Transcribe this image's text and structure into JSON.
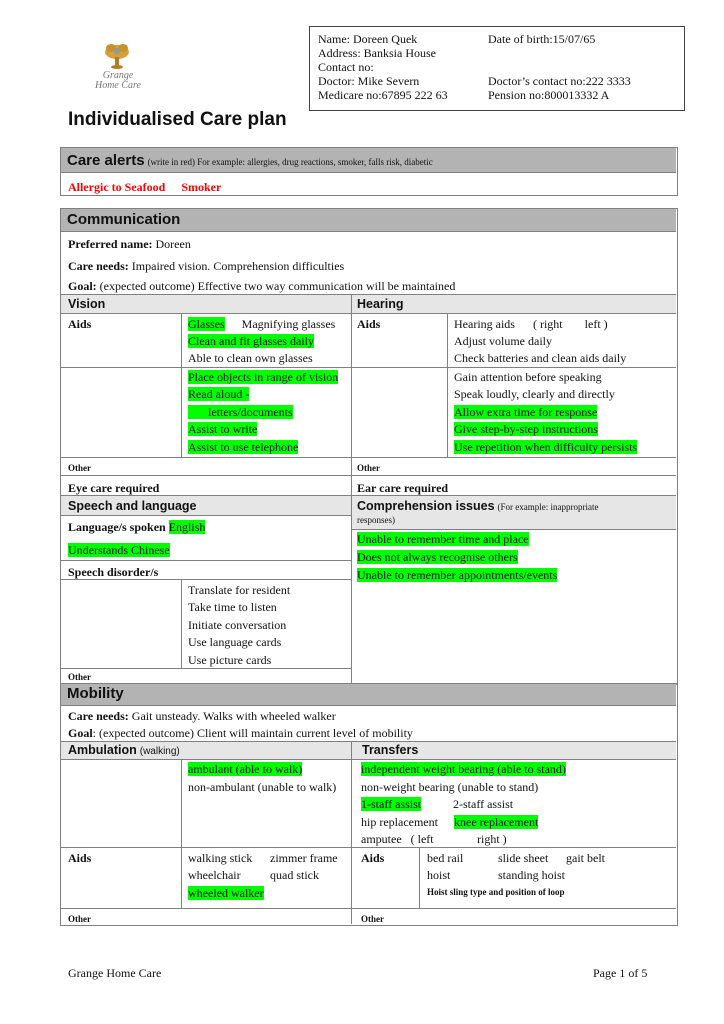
{
  "logo": {
    "line1": "Grange",
    "line2": "Home Care",
    "icon": "flower-logo-icon"
  },
  "title": "Individualised Care plan",
  "patient": {
    "name": "Name: Doreen Quek",
    "dob": "Date of birth:15/07/65",
    "address": "Address: Banksia House",
    "contact": "Contact no:",
    "doctor": "Doctor: Mike Severn",
    "doctor_contact": "Doctor’s contact no:222 3333",
    "medicare": "Medicare no:67895 222 63",
    "pension": "Pension no:800013332 A"
  },
  "care_alerts": {
    "heading": "Care alerts",
    "hint": "(write in red)  For example: allergies, drug reactions, smoker, falls risk, diabetic",
    "alerts": [
      "Allergic to Seafood",
      "Smoker"
    ],
    "alert_color": "#ff0000"
  },
  "communication": {
    "heading": "Communication",
    "preferred_name_label": "Preferred name:",
    "preferred_name": " Doreen",
    "care_needs_label": "Care needs:",
    "care_needs": " Impaired vision.  Comprehension difficulties",
    "goal_label": "Goal:",
    "goal": " (expected outcome) Effective two way communication will be maintained",
    "vision": {
      "heading": "Vision",
      "aids_label": "Aids",
      "aids": {
        "glasses": "Glasses",
        "magnifying": "Magnifying glasses",
        "clean_fit": "Clean and fit glasses daily",
        "able_clean": "Able to clean own glasses"
      },
      "support": [
        "Place objects in range of vision",
        "Read aloud -",
        "      letters/documents",
        "Assist to write",
        "Assist to use telephone"
      ],
      "other_label": "Other",
      "eye_care": "Eye care required"
    },
    "hearing": {
      "heading": "Hearing",
      "aids_label": "Aids",
      "aids": {
        "hearing_aids": "Hearing aids",
        "right": "( right",
        "left": "left )",
        "adjust": "Adjust volume daily",
        "check": "Check batteries and clean aids daily"
      },
      "support": [
        "Gain attention before speaking",
        "Speak loudly, clearly and directly",
        "Allow extra time for response",
        "Give step-by-step instructions",
        "Use repetition when difficulty persists"
      ],
      "other_label": "Other",
      "ear_care": "Ear care required"
    },
    "speech": {
      "heading": "Speech and language",
      "language_label": "Language/s spoken",
      "language": "English",
      "understands": "Understands Chinese",
      "disorder_label": "Speech disorder/s",
      "support": [
        "Translate for resident",
        "Take time to listen",
        "Initiate conversation",
        "Use language cards",
        "Use picture cards"
      ],
      "other_label": "Other"
    },
    "comprehension": {
      "heading": "Comprehension issues",
      "hint_line1": "(For example: inappropriate",
      "hint_line2": "responses)",
      "issues": [
        "Unable to remember time and place",
        "Does not always recognise others",
        "Unable to remember appointments/events"
      ]
    }
  },
  "mobility": {
    "heading": "Mobility",
    "care_needs_label": "Care needs:",
    "care_needs": " Gait unsteady.  Walks with wheeled walker",
    "goal_label": "Goal",
    "goal": ": (expected outcome) Client will maintain current level of mobility",
    "ambulation": {
      "heading": "Ambulation",
      "heading_hint": "(walking)",
      "ambulant": "ambulant (able to walk)",
      "non_ambulant": "non-ambulant (unable to walk)",
      "aids_label": "Aids",
      "aids": {
        "walking_stick": "walking stick",
        "zimmer": "zimmer frame",
        "wheelchair": "wheelchair",
        "quad": "quad stick",
        "wheeled_walker": "wheeled walker"
      },
      "other_label": "Other"
    },
    "transfers": {
      "heading": "Transfers",
      "independent": "independent weight bearing (able to stand)",
      "non_weight": "non-weight bearing (unable to stand)",
      "one_staff": "1-staff assist",
      "two_staff": "2-staff assist",
      "hip": "hip replacement",
      "knee": "knee replacement",
      "amputee": "amputee   ( left",
      "amputee_right": "right )",
      "aids_label": "Aids",
      "aids": {
        "bed_rail": "bed rail",
        "slide_sheet": "slide sheet",
        "gait_belt": "gait belt",
        "hoist": "hoist",
        "standing_hoist": "standing hoist"
      },
      "sling_note": "Hoist sling type and position of loop",
      "other_label": "Other"
    }
  },
  "footer": {
    "left": "Grange Home Care",
    "right": "Page 1 of 5"
  },
  "colors": {
    "highlight": "#00ff00",
    "section_header": "#b3b3b3",
    "sub_header": "#e6e6e6"
  }
}
